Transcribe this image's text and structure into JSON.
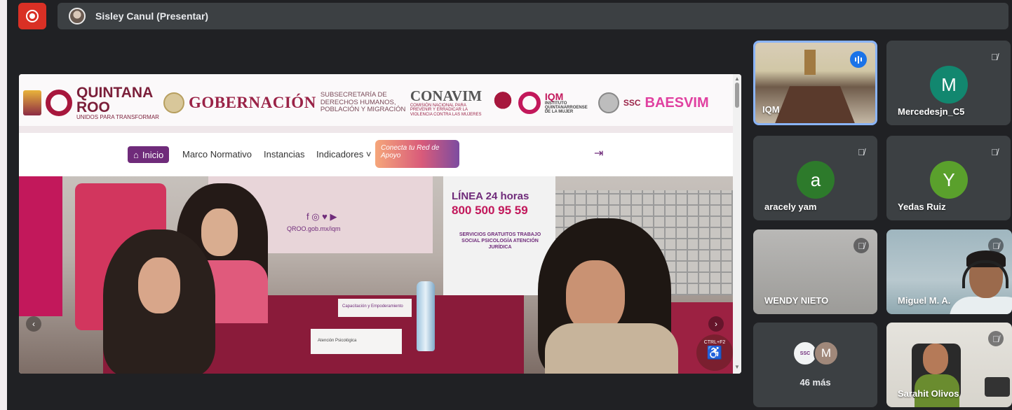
{
  "meeting": {
    "presenter_label": "Sisley Canul (Presentar)",
    "record_icon": "record-icon",
    "accent_color": "#d93025"
  },
  "shared_site": {
    "header": {
      "quintana": "QUINTANA",
      "roo": "ROO",
      "roo_sub": "UNIDOS PARA TRANSFORMAR",
      "gobernacion": "GOBERNACIÓN",
      "subsecretaria": "SUBSECRETARÍA DE DERECHOS HUMANOS, POBLACIÓN Y MIGRACIÓN",
      "conavim": "CONAVIM",
      "conavim_sub": "COMISIÓN NACIONAL PARA PREVENIR Y ERRADICAR LA VIOLENCIA CONTRA LAS MUJERES",
      "iqm": "IQM",
      "iqm_sub": "INSTITUTO QUINTANARROENSE DE LA MUJER",
      "ssc": "SSC",
      "baesvim": "BAESVIM"
    },
    "nav": {
      "home": "Inicio",
      "marco": "Marco Normativo",
      "instancias": "Instancias",
      "indicadores": "Indicadores ˅",
      "promo": "Conecta tu Red de Apoyo",
      "login_icon": "login-icon"
    },
    "hero": {
      "social": "f ◎ ♥ ▶",
      "url": "QROO.gob.mx/iqm",
      "linea": "LÍNEA 24 horas",
      "phone": "800 500 95 59",
      "servicios": "SERVICIOS GRATUITOS TRABAJO SOCIAL PSICOLOGÍA ATENCIÓN JURÍDICA",
      "sign1": "Capacitación y Empoderamiento",
      "sign2": "Atención Psicológica",
      "access_label": "CTRL+F2",
      "access_symbol": "♿"
    }
  },
  "participants": [
    {
      "name": "IQM",
      "state": "speaking"
    },
    {
      "name": "Mercedesjn_C5",
      "initial": "M",
      "color": "#12876f",
      "muted": true
    },
    {
      "name": "aracely yam",
      "initial": "a",
      "color": "#2d7a2b",
      "muted": true
    },
    {
      "name": "Yedas Ruiz",
      "initial": "Y",
      "color": "#5aa02c",
      "muted": true
    },
    {
      "name": "WENDY NIETO",
      "muted": true
    },
    {
      "name": "Miguel M. A.",
      "muted": true
    },
    {
      "more_initial": "M",
      "more_label": "46 más"
    },
    {
      "name": "Sarahit Olivos",
      "muted": true
    }
  ]
}
